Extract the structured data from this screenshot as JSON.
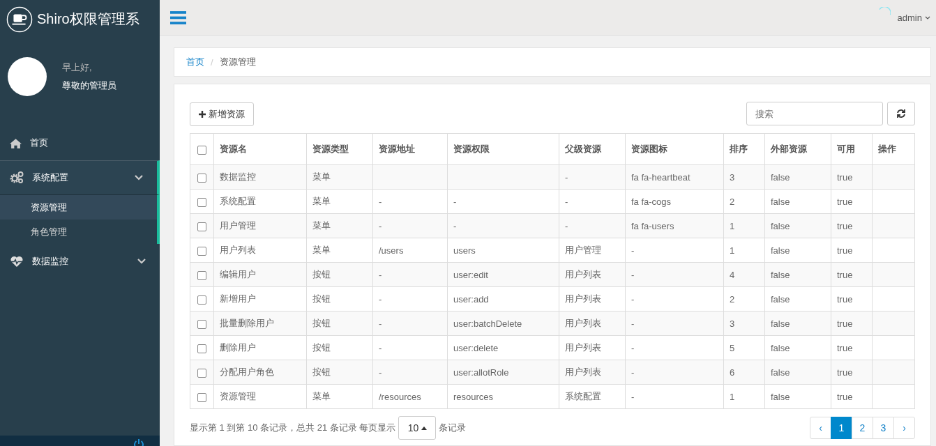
{
  "brand": {
    "title": "Shiro权限管理系"
  },
  "user": {
    "greeting": "早上好,",
    "name": "尊敬的管理员"
  },
  "menu": [
    {
      "label": "首页",
      "kind": "home",
      "expandable": false,
      "expanded": false
    },
    {
      "label": "系统配置",
      "kind": "settings",
      "expandable": true,
      "expanded": true,
      "children": [
        {
          "label": "资源管理",
          "selected": true
        },
        {
          "label": "角色管理",
          "selected": false
        }
      ]
    },
    {
      "label": "数据监控",
      "kind": "monitor",
      "expandable": true,
      "expanded": false
    }
  ],
  "header": {
    "username": "admin"
  },
  "breadcrumb": {
    "separator": "/",
    "items": [
      {
        "label": "首页",
        "link": true
      },
      {
        "label": "资源管理",
        "link": false
      }
    ]
  },
  "toolbar": {
    "add_button": "新增资源",
    "search": {
      "placeholder": "搜索"
    }
  },
  "table": {
    "select_all_checked": false,
    "columns": [
      "资源名",
      "资源类型",
      "资源地址",
      "资源权限",
      "父级资源",
      "资源图标",
      "排序",
      "外部资源",
      "可用",
      "操作"
    ],
    "rows": [
      {
        "checked": false,
        "cells": [
          "数据监控",
          "菜单",
          "",
          "",
          "-",
          "fa fa-heartbeat",
          "3",
          "false",
          "true",
          ""
        ]
      },
      {
        "checked": false,
        "cells": [
          "系统配置",
          "菜单",
          "-",
          "-",
          "-",
          "fa fa-cogs",
          "2",
          "false",
          "true",
          ""
        ]
      },
      {
        "checked": false,
        "cells": [
          "用户管理",
          "菜单",
          "-",
          "-",
          "-",
          "fa fa-users",
          "1",
          "false",
          "true",
          ""
        ]
      },
      {
        "checked": false,
        "cells": [
          "用户列表",
          "菜单",
          "/users",
          "users",
          "用户管理",
          "-",
          "1",
          "false",
          "true",
          ""
        ]
      },
      {
        "checked": false,
        "cells": [
          "编辑用户",
          "按钮",
          "-",
          "user:edit",
          "用户列表",
          "-",
          "4",
          "false",
          "true",
          ""
        ]
      },
      {
        "checked": false,
        "cells": [
          "新增用户",
          "按钮",
          "-",
          "user:add",
          "用户列表",
          "-",
          "2",
          "false",
          "true",
          ""
        ]
      },
      {
        "checked": false,
        "cells": [
          "批量删除用户",
          "按钮",
          "-",
          "user:batchDelete",
          "用户列表",
          "-",
          "3",
          "false",
          "true",
          ""
        ]
      },
      {
        "checked": false,
        "cells": [
          "删除用户",
          "按钮",
          "-",
          "user:delete",
          "用户列表",
          "-",
          "5",
          "false",
          "true",
          ""
        ]
      },
      {
        "checked": false,
        "cells": [
          "分配用户角色",
          "按钮",
          "-",
          "user:allotRole",
          "用户列表",
          "-",
          "6",
          "false",
          "true",
          ""
        ]
      },
      {
        "checked": false,
        "cells": [
          "资源管理",
          "菜单",
          "/resources",
          "resources",
          "系统配置",
          "-",
          "1",
          "false",
          "true",
          ""
        ]
      }
    ]
  },
  "footer": {
    "summary": "显示第 1 到第 10 条记录，总共 21 条记录 每页显示",
    "page_size": "10",
    "suffix": "条记录",
    "pages": [
      {
        "label": "‹",
        "selected": false
      },
      {
        "label": "1",
        "selected": true
      },
      {
        "label": "2",
        "selected": false
      },
      {
        "label": "3",
        "selected": false
      },
      {
        "label": "›",
        "selected": false
      }
    ]
  }
}
